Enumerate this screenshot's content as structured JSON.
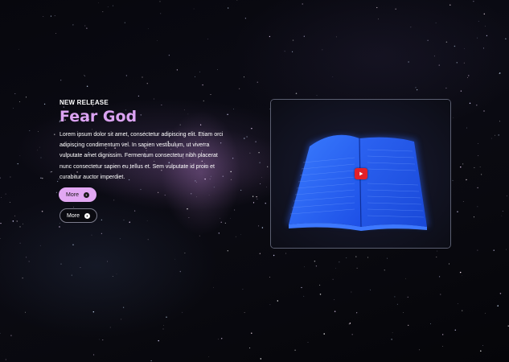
{
  "hero": {
    "eyebrow": "NEW RELEASE",
    "title": "Fear God",
    "body": "Lorem ipsum dolor sit amet, consectetur adipiscing elit. Etiam orci adipiscing condimentum vel. In sapien vestibulum, ut viverra vulputate amet dignissim. Fermentum consectetur nibh placerat nunc consectetur sapien eu tellus et. Sem vulputate id proin et curabitur auctor imperdiet."
  },
  "buttons": {
    "primary_label": "More",
    "secondary_label": "More"
  },
  "media": {
    "play_icon": "youtube-play-icon",
    "image": "glowing-blue-open-book"
  },
  "colors": {
    "accent": "#e2a8f3",
    "title": "#dba3f2",
    "play": "#e3202a",
    "book": "#1f5cff"
  },
  "icons": {
    "button_arrow": "arrow-right-circle-icon"
  }
}
